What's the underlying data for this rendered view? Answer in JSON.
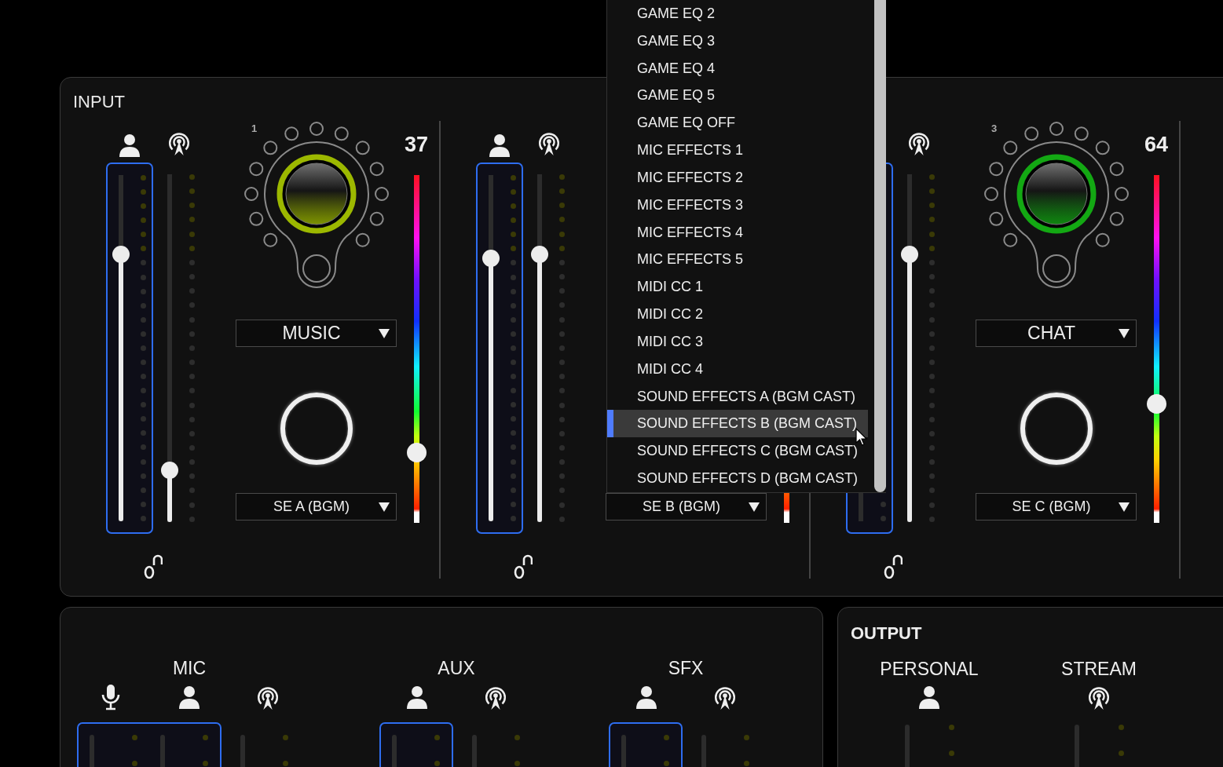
{
  "input": {
    "title": "INPUT",
    "strips": [
      {
        "faders": [
          {
            "kind": "personal",
            "level": 0.77
          },
          {
            "kind": "stream",
            "level": 0.15
          }
        ],
        "locked": false,
        "knob": {
          "number": "1",
          "color": "#9cb800"
        },
        "source": "MUSIC",
        "effect": "SE A (BGM)",
        "value": "37",
        "color_slider": {
          "level": 0.2
        }
      },
      {
        "faders": [
          {
            "kind": "personal",
            "level": 0.76
          },
          {
            "kind": "stream",
            "level": 0.77
          }
        ],
        "locked": false,
        "effect": "SE B (BGM)"
      },
      {
        "faders": [
          {
            "kind": "personal"
          },
          {
            "kind": "stream",
            "level": 0.77
          }
        ],
        "locked": false,
        "knob": {
          "number": "3",
          "color": "#13a813"
        },
        "source": "CHAT",
        "effect": "SE C (BGM)",
        "value": "64",
        "color_slider": {
          "level": 0.34
        }
      }
    ]
  },
  "menu": {
    "items": [
      {
        "label": "GAME EQ 2",
        "selected": false
      },
      {
        "label": "GAME EQ 3",
        "selected": false
      },
      {
        "label": "GAME EQ 4",
        "selected": false
      },
      {
        "label": "GAME EQ 5",
        "selected": false
      },
      {
        "label": "GAME EQ OFF",
        "selected": false
      },
      {
        "label": "MIC EFFECTS 1",
        "selected": false
      },
      {
        "label": "MIC EFFECTS 2",
        "selected": false
      },
      {
        "label": "MIC EFFECTS 3",
        "selected": false
      },
      {
        "label": "MIC EFFECTS 4",
        "selected": false
      },
      {
        "label": "MIC EFFECTS 5",
        "selected": false
      },
      {
        "label": "MIDI CC 1",
        "selected": false
      },
      {
        "label": "MIDI CC 2",
        "selected": false
      },
      {
        "label": "MIDI CC 3",
        "selected": false
      },
      {
        "label": "MIDI CC 4",
        "selected": false
      },
      {
        "label": "SOUND EFFECTS A (BGM CAST)",
        "selected": false
      },
      {
        "label": "SOUND EFFECTS B (BGM CAST)",
        "selected": true
      },
      {
        "label": "SOUND EFFECTS C (BGM CAST)",
        "selected": false
      },
      {
        "label": "SOUND EFFECTS D (BGM CAST)",
        "selected": false
      }
    ]
  },
  "mixer": {
    "groups": [
      {
        "label": "MIC",
        "channels": [
          {
            "kind": "mic"
          },
          {
            "kind": "personal"
          },
          {
            "kind": "stream"
          }
        ]
      },
      {
        "label": "AUX",
        "channels": [
          {
            "kind": "personal"
          },
          {
            "kind": "stream"
          }
        ]
      },
      {
        "label": "SFX",
        "channels": [
          {
            "kind": "personal"
          },
          {
            "kind": "stream"
          }
        ]
      }
    ]
  },
  "output": {
    "title": "OUTPUT",
    "channels": [
      {
        "label": "PERSONAL",
        "kind": "personal"
      },
      {
        "label": "STREAM",
        "kind": "stream"
      }
    ]
  }
}
